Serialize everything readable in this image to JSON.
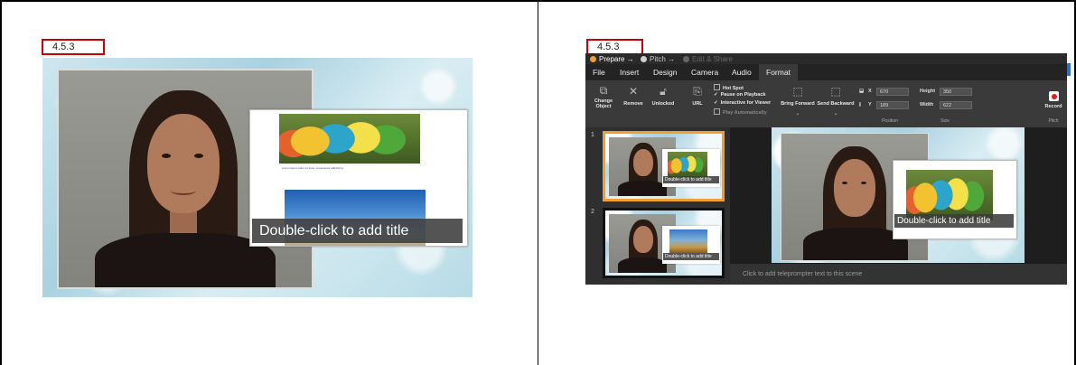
{
  "left": {
    "step_label": "4.5.3",
    "slide_title": "Double-click to add title",
    "caption": "Lorem ipsum dolor sit amet, consectetur adipiscing"
  },
  "right": {
    "step_label": "4.5.3",
    "workflow": [
      {
        "label": "Prepare",
        "arrow": "→",
        "color": "#f0a030"
      },
      {
        "label": "Pitch",
        "arrow": "→",
        "color": "#d0d0d0"
      },
      {
        "label": "Edit & Share",
        "arrow": "",
        "color": "#666666"
      }
    ],
    "menu": [
      "File",
      "Insert",
      "Design",
      "Camera",
      "Audio",
      "Format"
    ],
    "active_menu": "Format",
    "ribbon": {
      "change_object": "Change Object",
      "remove": "Remove",
      "unlocked": "Unlocked",
      "url": "URL",
      "hot_spot": "Hot Spot",
      "pause_on_playback": "Pause on Playback",
      "interactive_for_viewer": "Interactive for Viewer",
      "play_automatically": "Play Automatically",
      "bring_forward": "Bring Forward",
      "send_backward": "Send Backward",
      "x_label": "X",
      "x_value": "670",
      "y_label": "Y",
      "y_value": "189",
      "height_label": "Height",
      "height_value": "350",
      "width_label": "Width",
      "width_value": "622",
      "position_group": "Position",
      "size_group": "Size",
      "record": "Record",
      "pitch_group": "Pitch"
    },
    "scenes": [
      {
        "number": "1",
        "title": "Double-click to add title"
      },
      {
        "number": "2",
        "title": "Double-click to add title"
      }
    ],
    "canvas_title": "Double-click to add title",
    "teleprompter": "Click to add teleprompter text to this scene"
  }
}
